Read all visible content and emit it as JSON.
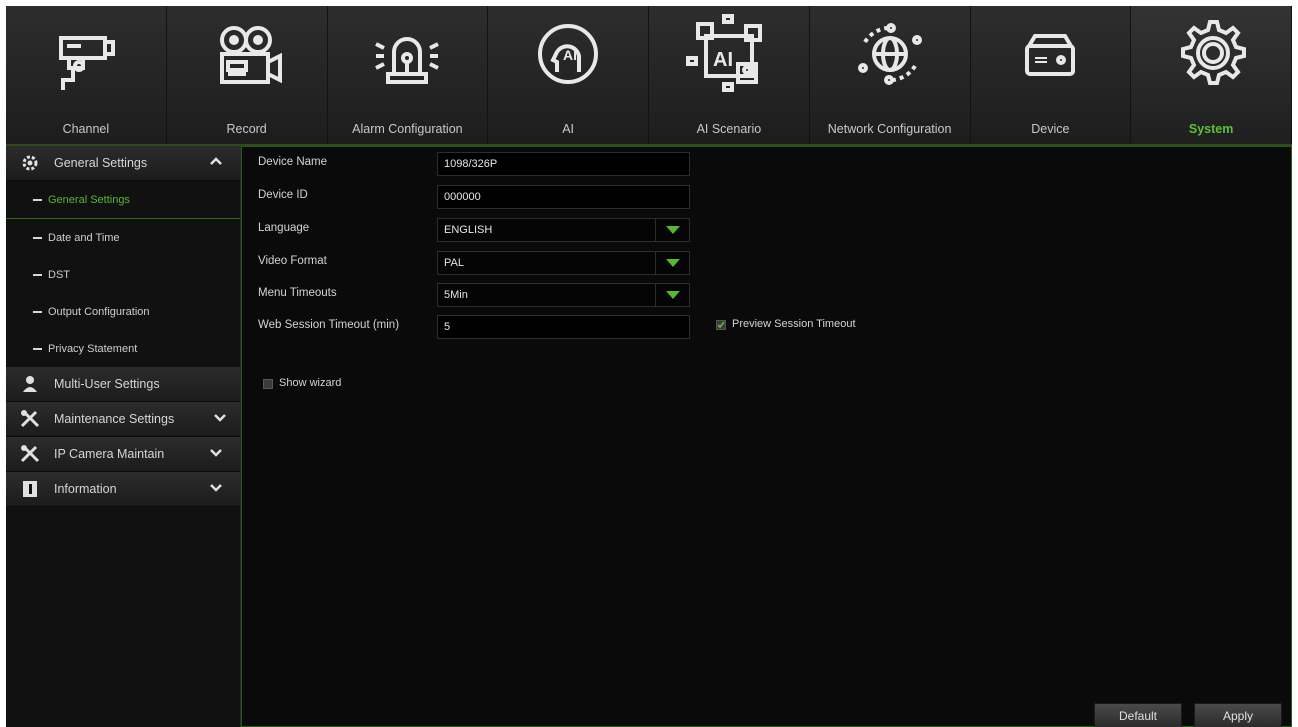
{
  "nav": {
    "items": [
      {
        "label": "Channel",
        "icon": "camera-icon"
      },
      {
        "label": "Record",
        "icon": "record-icon"
      },
      {
        "label": "Alarm Configuration",
        "icon": "alarm-icon"
      },
      {
        "label": "AI",
        "icon": "ai-icon"
      },
      {
        "label": "AI Scenario",
        "icon": "ai-scenario-icon"
      },
      {
        "label": "Network Configuration",
        "icon": "network-icon"
      },
      {
        "label": "Device",
        "icon": "device-icon"
      },
      {
        "label": "System",
        "icon": "gear-icon"
      }
    ],
    "active": "System"
  },
  "sidebar": {
    "general_title": "General Settings",
    "sub_items": [
      "General Settings",
      "Date and Time",
      "DST",
      "Output Configuration",
      "Privacy Statement"
    ],
    "multi_user": "Multi-User Settings",
    "maintenance": "Maintenance Settings",
    "ip_camera": "IP Camera Maintain",
    "information": "Information"
  },
  "form": {
    "device_name_label": "Device Name",
    "device_name_value": "1098/326P",
    "device_id_label": "Device ID",
    "device_id_value": "000000",
    "language_label": "Language",
    "language_value": "ENGLISH",
    "video_format_label": "Video Format",
    "video_format_value": "PAL",
    "menu_timeouts_label": "Menu Timeouts",
    "menu_timeouts_value": "5Min",
    "web_session_label": "Web Session Timeout (min)",
    "web_session_value": "5",
    "preview_session_label": "Preview Session Timeout",
    "preview_session_checked": true,
    "show_wizard_label": "Show wizard",
    "show_wizard_checked": false
  },
  "buttons": {
    "default": "Default",
    "apply": "Apply"
  },
  "colors": {
    "accent": "#58b82f",
    "background": "#0b0b0b"
  }
}
